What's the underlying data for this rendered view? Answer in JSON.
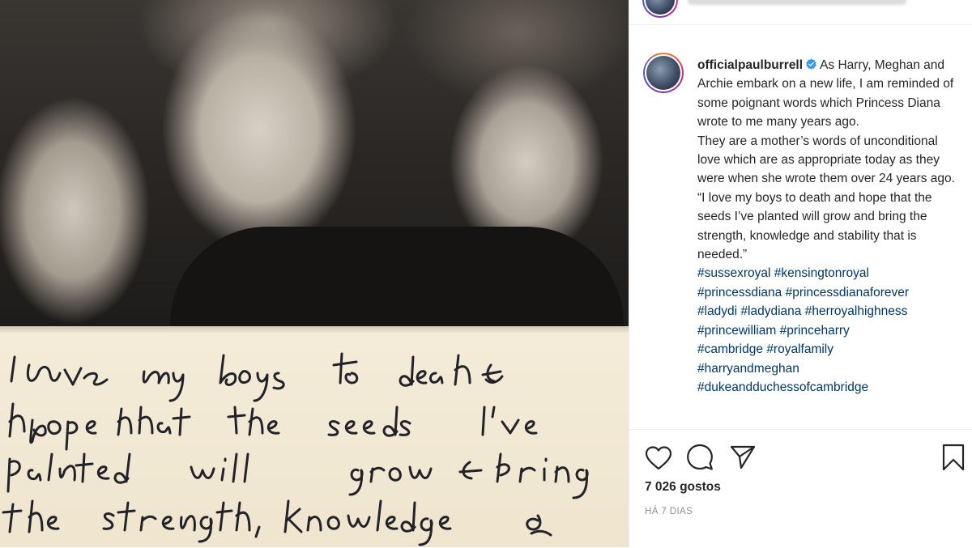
{
  "post": {
    "username": "officialpaulburrell",
    "verified": true,
    "caption_lines": [
      "As Harry, Meghan and Archie embark on a new life, I am reminded of some poignant words which Princess Diana wrote to me many years ago.",
      "They are a mother’s words of unconditional love which are as appropriate today as they were when she wrote them over 24 years ago.",
      "“I love my boys to death and hope that the seeds I’ve planted will grow and bring the strength, knowledge and stability that is needed.”"
    ],
    "hashtags": [
      [
        "#sussexroyal",
        "#kensingtonroyal"
      ],
      [
        "#princessdiana",
        "#princessdianaforever"
      ],
      [
        "#ladydi",
        "#ladydiana",
        "#herroyalhighness"
      ],
      [
        "#princewilliam",
        "#princeharry"
      ],
      [
        "#cambridge",
        "#royalfamily"
      ],
      [
        "#harryandmeghan"
      ],
      [
        "#dukeandduchessofcambridge"
      ]
    ],
    "likes_label": "7 026 gostos",
    "time_label": "HÁ 7 DIAS"
  },
  "image": {
    "handwritten_note_lines": [
      "I love my boys to death &",
      "hope that the seeds I've",
      "planted will grow & bring",
      "the strength, knowledge &"
    ]
  },
  "icons": {
    "like": "heart-icon",
    "comment": "comment-icon",
    "share": "paper-plane-icon",
    "save": "bookmark-icon",
    "verified": "verified-badge-icon"
  },
  "colors": {
    "hashtag": "#00376b",
    "text": "#262626",
    "muted": "#8e8e8e",
    "verified": "#3897f0"
  }
}
